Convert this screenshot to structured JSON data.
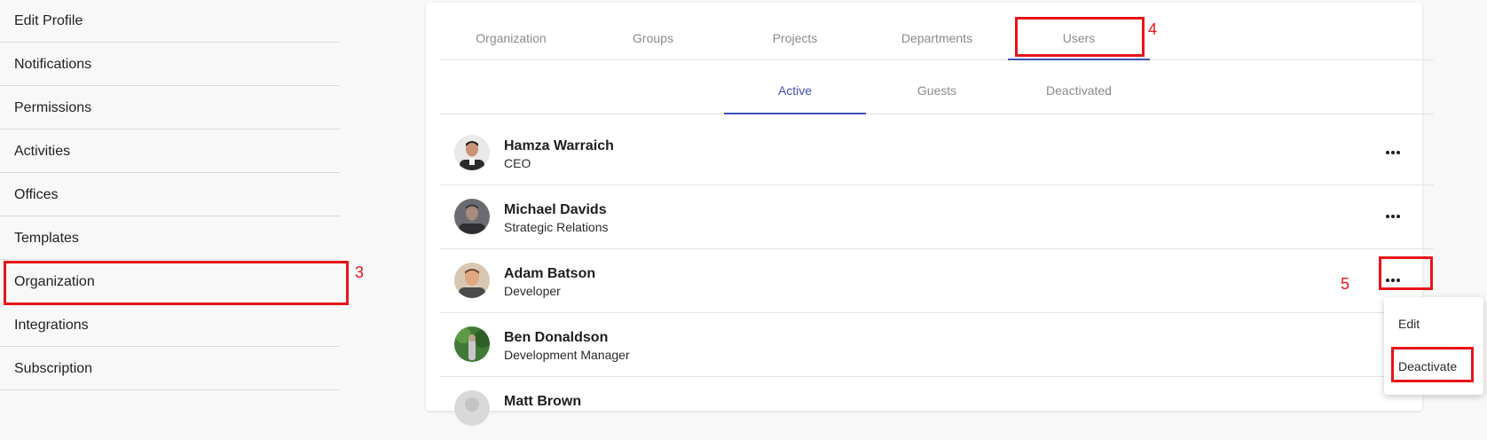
{
  "sidebar": {
    "items": [
      {
        "label": "Edit Profile"
      },
      {
        "label": "Notifications"
      },
      {
        "label": "Permissions"
      },
      {
        "label": "Activities"
      },
      {
        "label": "Offices"
      },
      {
        "label": "Templates"
      },
      {
        "label": "Organization"
      },
      {
        "label": "Integrations"
      },
      {
        "label": "Subscription"
      }
    ]
  },
  "main_tabs": [
    {
      "label": "Organization"
    },
    {
      "label": "Groups"
    },
    {
      "label": "Projects"
    },
    {
      "label": "Departments"
    },
    {
      "label": "Users"
    }
  ],
  "sub_tabs": [
    {
      "label": "Active"
    },
    {
      "label": "Guests"
    },
    {
      "label": "Deactivated"
    }
  ],
  "users": [
    {
      "name": "Hamza Warraich",
      "role": "CEO"
    },
    {
      "name": "Michael Davids",
      "role": "Strategic Relations"
    },
    {
      "name": "Adam Batson",
      "role": "Developer"
    },
    {
      "name": "Ben Donaldson",
      "role": "Development Manager"
    },
    {
      "name": "Matt Brown",
      "role": ""
    }
  ],
  "context_menu": {
    "edit_label": "Edit",
    "deactivate_label": "Deactivate"
  },
  "annotations": {
    "step3": "3",
    "step4": "4",
    "step5": "5"
  },
  "colors": {
    "accent": "#3f51b5",
    "annotation": "#e8141b"
  },
  "icons": {
    "more": "more-horizontal-icon"
  }
}
